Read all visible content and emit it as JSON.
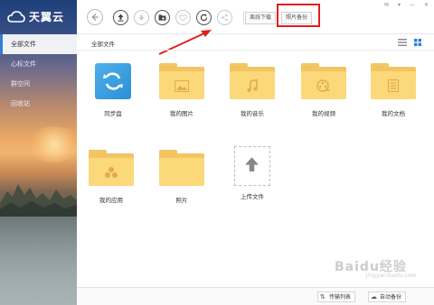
{
  "app": {
    "name": "天翼云"
  },
  "sidebar": {
    "items": [
      {
        "label": "全部文件",
        "active": true
      },
      {
        "label": "心标文件",
        "active": false
      },
      {
        "label": "群空间",
        "active": false
      },
      {
        "label": "回收站",
        "active": false
      }
    ]
  },
  "toolbar": {
    "back_icon": "back-arrow-icon",
    "upload_icon": "upload-icon",
    "download_icon": "download-icon",
    "new_folder_icon": "new-folder-icon",
    "favorite_icon": "heart-icon",
    "refresh_icon": "refresh-icon",
    "share_icon": "share-icon",
    "batch_download_label": "离线下载",
    "photo_backup_label": "照片备份",
    "highlight_color": "#e02020"
  },
  "content": {
    "breadcrumb": "全部文件",
    "files": [
      {
        "label": "同步盘",
        "kind": "sync"
      },
      {
        "label": "我的图片",
        "kind": "folder",
        "glyph": "image"
      },
      {
        "label": "我的音乐",
        "kind": "folder",
        "glyph": "music"
      },
      {
        "label": "我的视频",
        "kind": "folder",
        "glyph": "film"
      },
      {
        "label": "我的文档",
        "kind": "folder",
        "glyph": "doc"
      },
      {
        "label": "我的应用",
        "kind": "folder",
        "glyph": "apps"
      },
      {
        "label": "照片",
        "kind": "folder",
        "glyph": "none"
      },
      {
        "label": "上传文件",
        "kind": "upload"
      }
    ]
  },
  "statusbar": {
    "transfer_label": "传输列表",
    "autobackup_label": "自动备份"
  },
  "watermark": {
    "main": "Baidu经验",
    "sub": "jingyan.baidu.com"
  }
}
